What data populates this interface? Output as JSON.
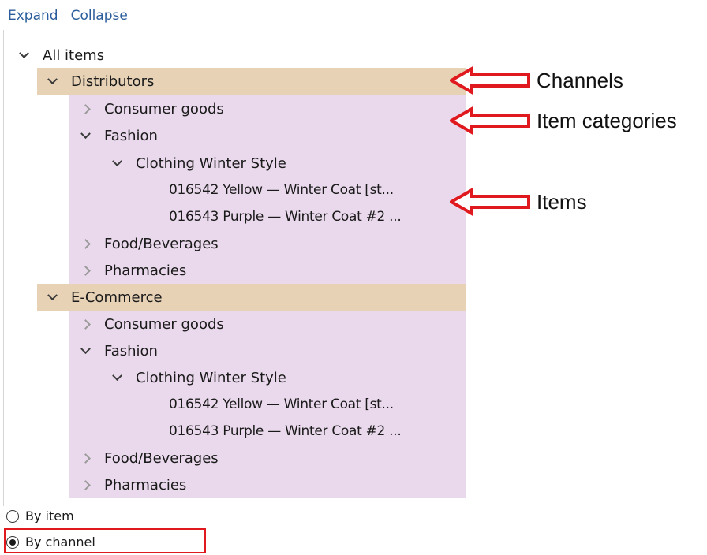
{
  "toolbar": {
    "expand": "Expand",
    "collapse": "Collapse"
  },
  "tree": {
    "root": "All items",
    "channels": [
      {
        "label": "Distributors",
        "categories": [
          {
            "label": "Consumer goods"
          },
          {
            "label": "Fashion",
            "sub": {
              "label": "Clothing Winter Style",
              "items": [
                "016542 Yellow — Winter Coat [st...",
                "016543 Purple — Winter Coat #2 ..."
              ]
            }
          },
          {
            "label": "Food/Beverages"
          },
          {
            "label": "Pharmacies"
          }
        ]
      },
      {
        "label": "E-Commerce",
        "categories": [
          {
            "label": "Consumer goods"
          },
          {
            "label": "Fashion",
            "sub": {
              "label": "Clothing Winter Style",
              "items": [
                "016542 Yellow — Winter Coat [st...",
                "016543 Purple — Winter Coat #2 ..."
              ]
            }
          },
          {
            "label": "Food/Beverages"
          },
          {
            "label": "Pharmacies"
          }
        ]
      }
    ]
  },
  "annotations": {
    "channels": "Channels",
    "categories": "Item categories",
    "items": "Items"
  },
  "radio": {
    "by_item": "By item",
    "by_channel": "By channel",
    "selected": "by_channel"
  },
  "colors": {
    "channel_bg": "#e7d2b6",
    "children_bg": "#ead9ec",
    "annotation_red": "#e0191e",
    "link": "#2b5d9c"
  }
}
